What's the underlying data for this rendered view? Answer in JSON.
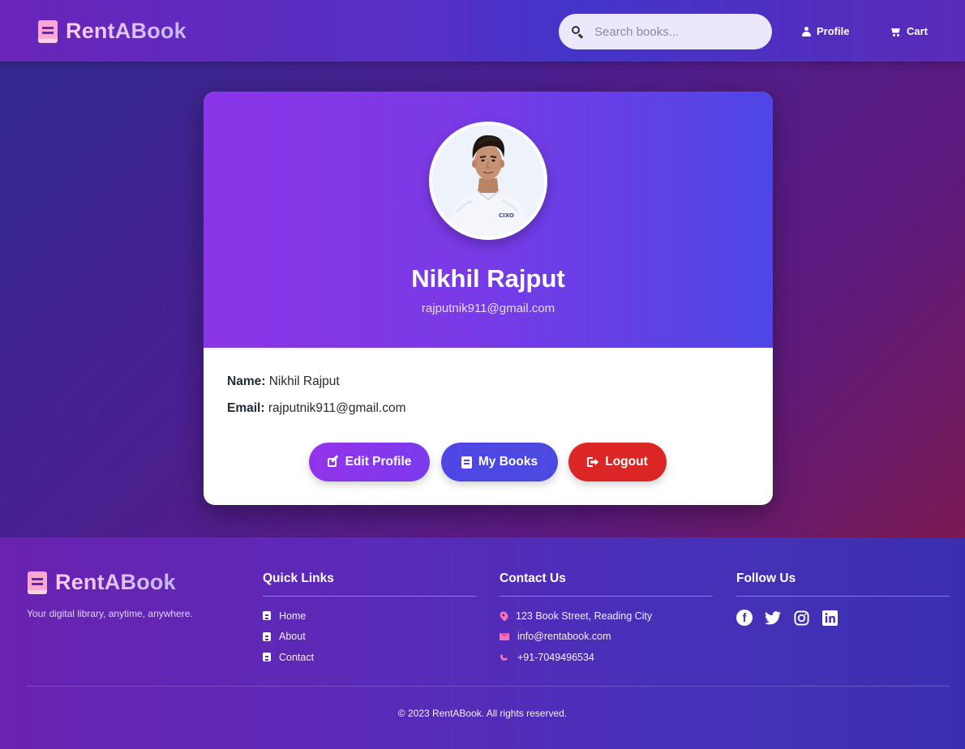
{
  "navbar": {
    "brand": "RentABook",
    "search_placeholder": "Search books...",
    "profile_label": "Profile",
    "cart_label": "Cart"
  },
  "profile": {
    "name": "Nikhil Rajput",
    "email": "rajputnik911@gmail.com",
    "name_label": "Name:",
    "email_label": "Email:",
    "name_value": "Nikhil Rajput",
    "email_value": "rajputnik911@gmail.com",
    "buttons": {
      "edit": "Edit Profile",
      "books": "My Books",
      "logout": "Logout"
    },
    "shirt_text": "CIXO"
  },
  "footer": {
    "brand": "RentABook",
    "tagline": "Your digital library, anytime, anywhere.",
    "quick_links": {
      "title": "Quick Links",
      "items": [
        "Home",
        "About",
        "Contact"
      ]
    },
    "contact": {
      "title": "Contact Us",
      "address": "123 Book Street, Reading City",
      "email": "info@rentabook.com",
      "phone": "+91-7049496534"
    },
    "follow": {
      "title": "Follow Us",
      "icons": [
        "facebook-icon",
        "twitter-icon",
        "instagram-icon",
        "linkedin-icon"
      ]
    },
    "copyright": "© 2023 RentABook. All rights reserved."
  },
  "colors": {
    "accent_purple": "#9333ea",
    "accent_indigo": "#4f46e5",
    "danger_red": "#dc2626",
    "brand_pink": "#f9a8d4"
  }
}
